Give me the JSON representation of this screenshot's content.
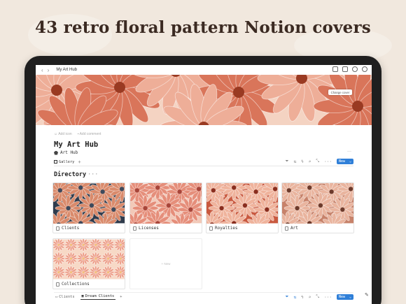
{
  "headline": "43 retro floral pattern Notion covers",
  "topbar": {
    "back_arrow": "‹",
    "forward_arrow": "›",
    "breadcrumb": "My Art Hub",
    "icons": [
      "folder-icon",
      "comment-icon",
      "clock-icon",
      "more-icon"
    ]
  },
  "cover": {
    "change_cover_label": "Change cover",
    "colors": {
      "base": "#f4d3c2",
      "petal_dark": "#d9755a",
      "petal_light": "#eeae98",
      "center": "#9a3a22"
    }
  },
  "page_actions": {
    "add_icon": "Add icon",
    "add_comment": "Add comment"
  },
  "page": {
    "title": "My Art Hub",
    "subtitle": "Art Hub",
    "more": "···"
  },
  "view_tab": {
    "label": "Gallery",
    "add": "+"
  },
  "toolbar": {
    "new_label": "New",
    "new_chevron": "⌄"
  },
  "directory": {
    "title": "Directory",
    "dots": "···",
    "cards": [
      {
        "label": "Clients"
      },
      {
        "label": "Licenses"
      },
      {
        "label": "Royalties"
      },
      {
        "label": "Art"
      },
      {
        "label": "Collections"
      }
    ],
    "new_card": "+ New"
  },
  "bottom_tabs": [
    {
      "label": "Clients"
    },
    {
      "label": "Dream Clients"
    }
  ],
  "bottom_add": "+",
  "accent_color": "#2f7fd8"
}
